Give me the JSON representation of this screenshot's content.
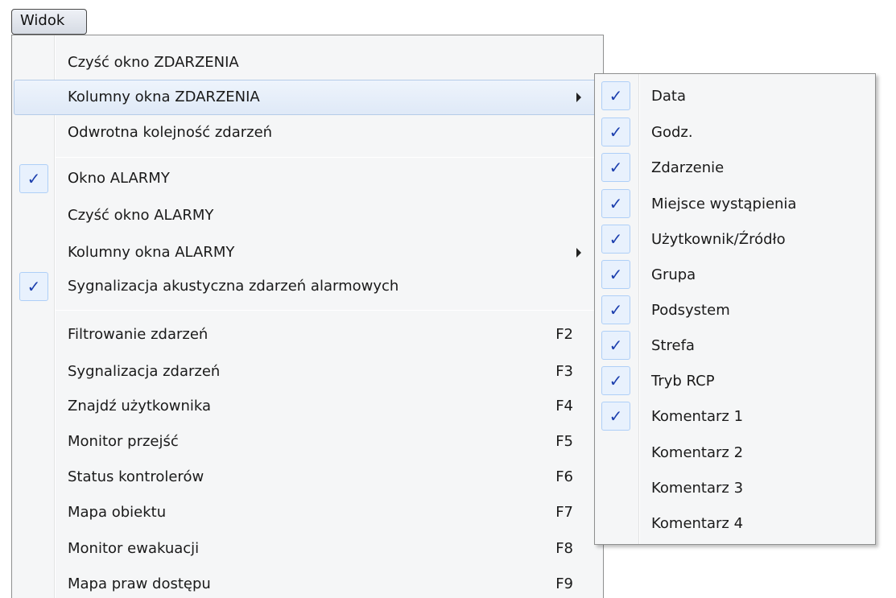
{
  "menubar": {
    "widok_label": "Widok"
  },
  "menu": {
    "items": [
      {
        "label": "Czyść okno ZDARZENIA"
      },
      {
        "label": "Kolumny okna ZDARZENIA"
      },
      {
        "label": "Odwrotna kolejność zdarzeń"
      },
      {
        "label": "Okno ALARMY",
        "checked": true
      },
      {
        "label": "Czyść okno ALARMY"
      },
      {
        "label": "Kolumny okna ALARMY"
      },
      {
        "label": "Sygnalizacja akustyczna zdarzeń alarmowych",
        "checked": true
      },
      {
        "label": "Filtrowanie zdarzeń",
        "shortcut": "F2"
      },
      {
        "label": "Sygnalizacja zdarzeń",
        "shortcut": "F3"
      },
      {
        "label": "Znajdź użytkownika",
        "shortcut": "F4"
      },
      {
        "label": "Monitor przejść",
        "shortcut": "F5"
      },
      {
        "label": "Status kontrolerów",
        "shortcut": "F6"
      },
      {
        "label": "Mapa obiektu",
        "shortcut": "F7"
      },
      {
        "label": "Monitor ewakuacji",
        "shortcut": "F8"
      },
      {
        "label": "Mapa praw dostępu",
        "shortcut": "F9"
      }
    ]
  },
  "submenu": {
    "items": [
      {
        "label": "Data",
        "checked": true
      },
      {
        "label": "Godz.",
        "checked": true
      },
      {
        "label": "Zdarzenie",
        "checked": true
      },
      {
        "label": "Miejsce wystąpienia",
        "checked": true
      },
      {
        "label": "Użytkownik/Źródło",
        "checked": true
      },
      {
        "label": "Grupa",
        "checked": true
      },
      {
        "label": "Podsystem",
        "checked": true
      },
      {
        "label": "Strefa",
        "checked": true
      },
      {
        "label": "Tryb RCP",
        "checked": true
      },
      {
        "label": "Komentarz 1",
        "checked": true
      },
      {
        "label": "Komentarz 2",
        "checked": false
      },
      {
        "label": "Komentarz 3",
        "checked": false
      },
      {
        "label": "Komentarz 4",
        "checked": false
      }
    ]
  },
  "icons": {
    "check": "checkmark-icon",
    "submenu_arrow": "submenu-arrow-icon"
  },
  "colors": {
    "check": "#1c3fae",
    "hover_border": "#b4cbe8"
  }
}
